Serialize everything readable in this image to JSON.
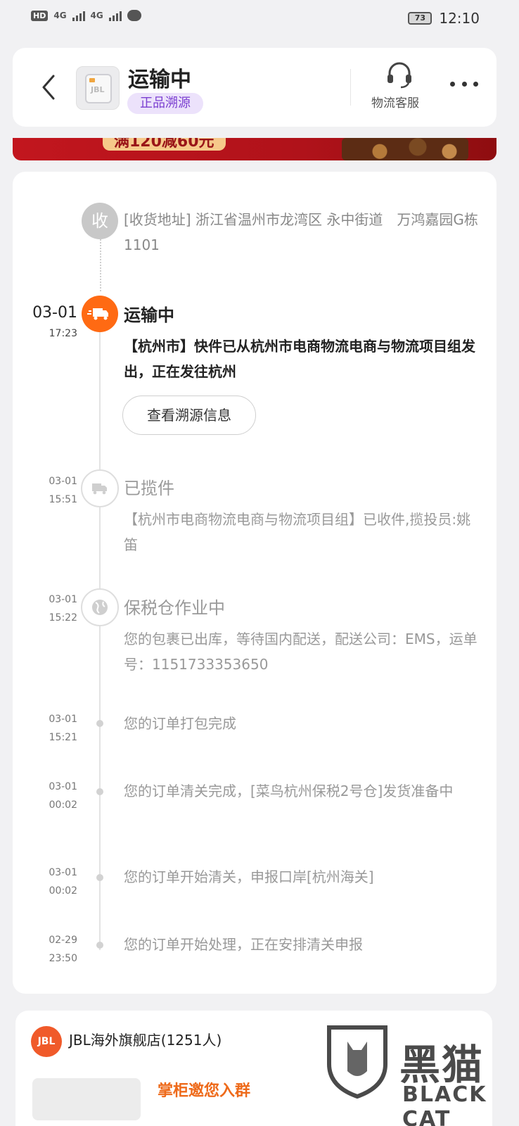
{
  "status_bar": {
    "hd": "HD",
    "net1": "4G",
    "net2": "4G",
    "battery": "73",
    "time": "12:10"
  },
  "header": {
    "product_thumb_label": "JBL",
    "title": "运输中",
    "tag": "正品溯源",
    "customer_service_label": "物流客服"
  },
  "banner": {
    "text": "满120减60元"
  },
  "timeline": {
    "address_node": "收",
    "address": "[收货地址] 浙江省温州市龙湾区 永中街道　万鸿嘉园G栋1101",
    "events": [
      {
        "date": "03-01",
        "time": "17:23",
        "status": "运输中",
        "detail": "【杭州市】快件已从杭州市电商物流电商与物流项目组发出，正在发往杭州"
      },
      {
        "date": "03-01",
        "time": "15:51",
        "status": "已揽件",
        "detail": "【杭州市电商物流电商与物流项目组】已收件,揽投员:姚笛"
      },
      {
        "date": "03-01",
        "time": "15:22",
        "status": "保税仓作业中",
        "detail": "您的包裹已出库，等待国内配送，配送公司：EMS，运单号：1151733353650"
      },
      {
        "date": "03-01",
        "time": "15:21",
        "detail": "您的订单打包完成"
      },
      {
        "date": "03-01",
        "time": "00:02",
        "detail": "您的订单清关完成，[菜鸟杭州保税2号仓]发货准备中"
      },
      {
        "date": "03-01",
        "time": "00:02",
        "detail": "您的订单开始清关，申报口岸[杭州海关]"
      },
      {
        "date": "02-29",
        "time": "23:50",
        "detail": "您的订单开始处理，正在安排清关申报"
      }
    ],
    "trace_button": "查看溯源信息"
  },
  "store": {
    "logo_text": "JBL",
    "name": "JBL海外旗舰店(1251人)",
    "invite": "掌柜邀您入群"
  },
  "watermark": {
    "text1": "黑猫",
    "text2": "BLACK CAT"
  },
  "colors": {
    "accent": "#ff6a13",
    "tag_bg": "#ece2fb",
    "tag_text": "#7b3fd1"
  }
}
